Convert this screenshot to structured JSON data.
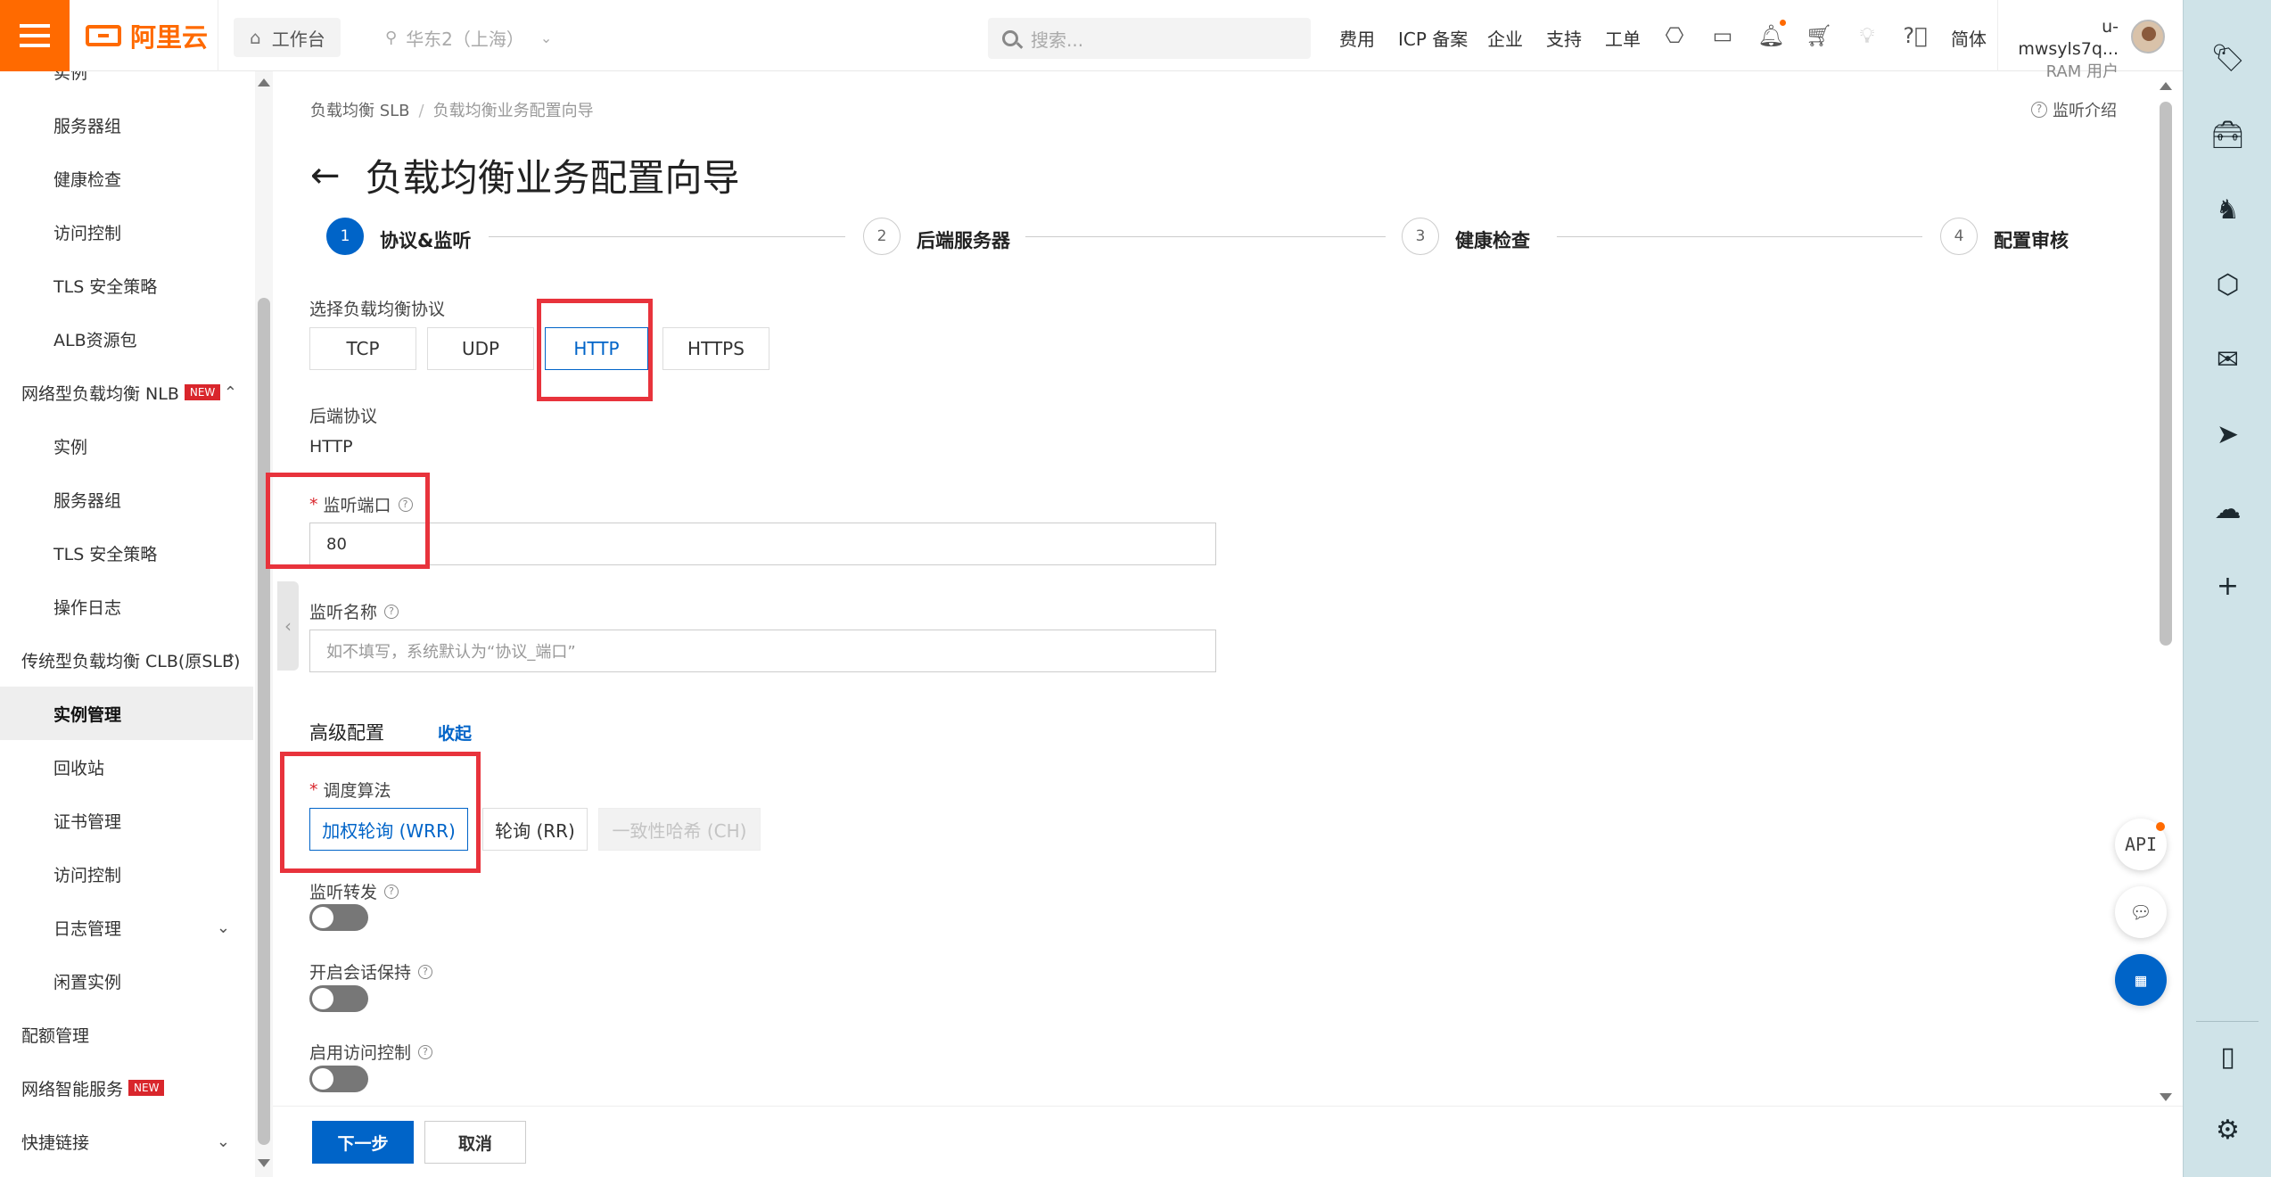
{
  "topbar": {
    "logo_text": "阿里云",
    "workbench": "工作台",
    "region": "华东2（上海）",
    "search_placeholder": "搜索...",
    "nav": [
      "费用",
      "ICP 备案",
      "企业",
      "支持",
      "工单"
    ],
    "lang": "简体",
    "user_name": "u-mwsyls7q...",
    "user_role": "RAM 用户"
  },
  "sidebar": {
    "items": [
      {
        "label": "实例"
      },
      {
        "label": "服务器组"
      },
      {
        "label": "健康检查"
      },
      {
        "label": "访问控制"
      },
      {
        "label": "TLS 安全策略"
      },
      {
        "label": "ALB资源包"
      },
      {
        "label": "网络型负载均衡 NLB",
        "tag": "NEW"
      },
      {
        "label": "实例"
      },
      {
        "label": "服务器组"
      },
      {
        "label": "TLS 安全策略"
      },
      {
        "label": "操作日志"
      },
      {
        "label": "传统型负载均衡 CLB(原SLB)"
      },
      {
        "label": "实例管理"
      },
      {
        "label": "回收站"
      },
      {
        "label": "证书管理"
      },
      {
        "label": "访问控制"
      },
      {
        "label": "日志管理"
      },
      {
        "label": "闲置实例"
      },
      {
        "label": "配额管理"
      },
      {
        "label": "网络智能服务",
        "tag": "NEW"
      },
      {
        "label": "快捷链接"
      }
    ]
  },
  "breadcrumb": {
    "root": "负载均衡 SLB",
    "sep": "/",
    "current": "负载均衡业务配置向导"
  },
  "help_link": "监听介绍",
  "page_title": "负载均衡业务配置向导",
  "steps": [
    {
      "num": "1",
      "label": "协议&监听"
    },
    {
      "num": "2",
      "label": "后端服务器"
    },
    {
      "num": "3",
      "label": "健康检查"
    },
    {
      "num": "4",
      "label": "配置审核"
    }
  ],
  "form": {
    "protocol_label": "选择负载均衡协议",
    "protocols": [
      "TCP",
      "UDP",
      "HTTP",
      "HTTPS"
    ],
    "selected_protocol": "HTTP",
    "backend_protocol_label": "后端协议",
    "backend_protocol_value": "HTTP",
    "port_label": "监听端口",
    "port_value": "80",
    "name_label": "监听名称",
    "name_placeholder": "如不填写，系统默认为“协议_端口”",
    "advanced_label": "高级配置",
    "advanced_toggle": "收起",
    "algo_label": "调度算法",
    "algos": [
      "加权轮询 (WRR)",
      "轮询 (RR)",
      "一致性哈希 (CH)"
    ],
    "forward_label": "监听转发",
    "session_label": "开启会话保持",
    "acl_label": "启用访问控制",
    "forward_on": false,
    "session_on": false,
    "acl_on": false
  },
  "footer": {
    "next": "下一步",
    "cancel": "取消"
  },
  "float_buttons": {
    "api": "API"
  },
  "colors": {
    "accent": "#0064c8",
    "brand": "#ff6a00",
    "highlight": "#e8333c"
  }
}
